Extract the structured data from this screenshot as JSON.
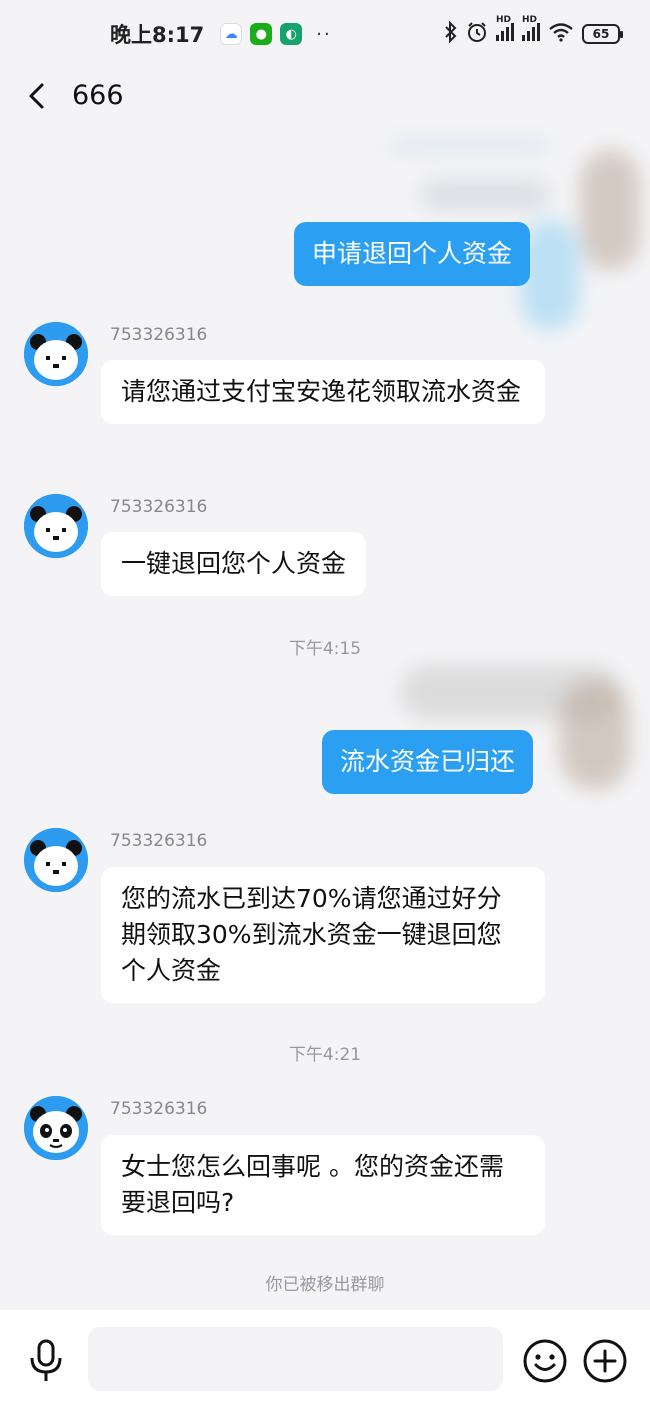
{
  "status_bar": {
    "time": "晚上8:17",
    "dots": "··",
    "hd1": "HD",
    "hd2": "HD",
    "battery": "65"
  },
  "header": {
    "title": "666"
  },
  "messages": [
    {
      "type": "out",
      "text": "申请退回个人资金"
    },
    {
      "type": "in",
      "sender": "753326316",
      "text": "请您通过支付宝安逸花领取流水资金"
    },
    {
      "type": "in",
      "sender": "753326316",
      "text": "一键退回您个人资金"
    },
    {
      "type": "time",
      "text": "下午4:15"
    },
    {
      "type": "out",
      "text": "流水资金已归还"
    },
    {
      "type": "in",
      "sender": "753326316",
      "text": "您的流水已到达70%请您通过好分期领取30%到流水资金一键退回您个人资金"
    },
    {
      "type": "time",
      "text": "下午4:21"
    },
    {
      "type": "in",
      "sender": "753326316",
      "text": "女士您怎么回事呢 。您的资金还需要退回吗?"
    }
  ],
  "system_note": "你已被移出群聊",
  "colors": {
    "bubble_out": "#2b9ff2",
    "avatar_bg": "#2d9cf0",
    "background": "#f4f4f6"
  },
  "icons": {
    "back": "chevron-left-icon",
    "mic": "microphone-icon",
    "emoji": "smiley-icon",
    "plus": "plus-icon"
  }
}
